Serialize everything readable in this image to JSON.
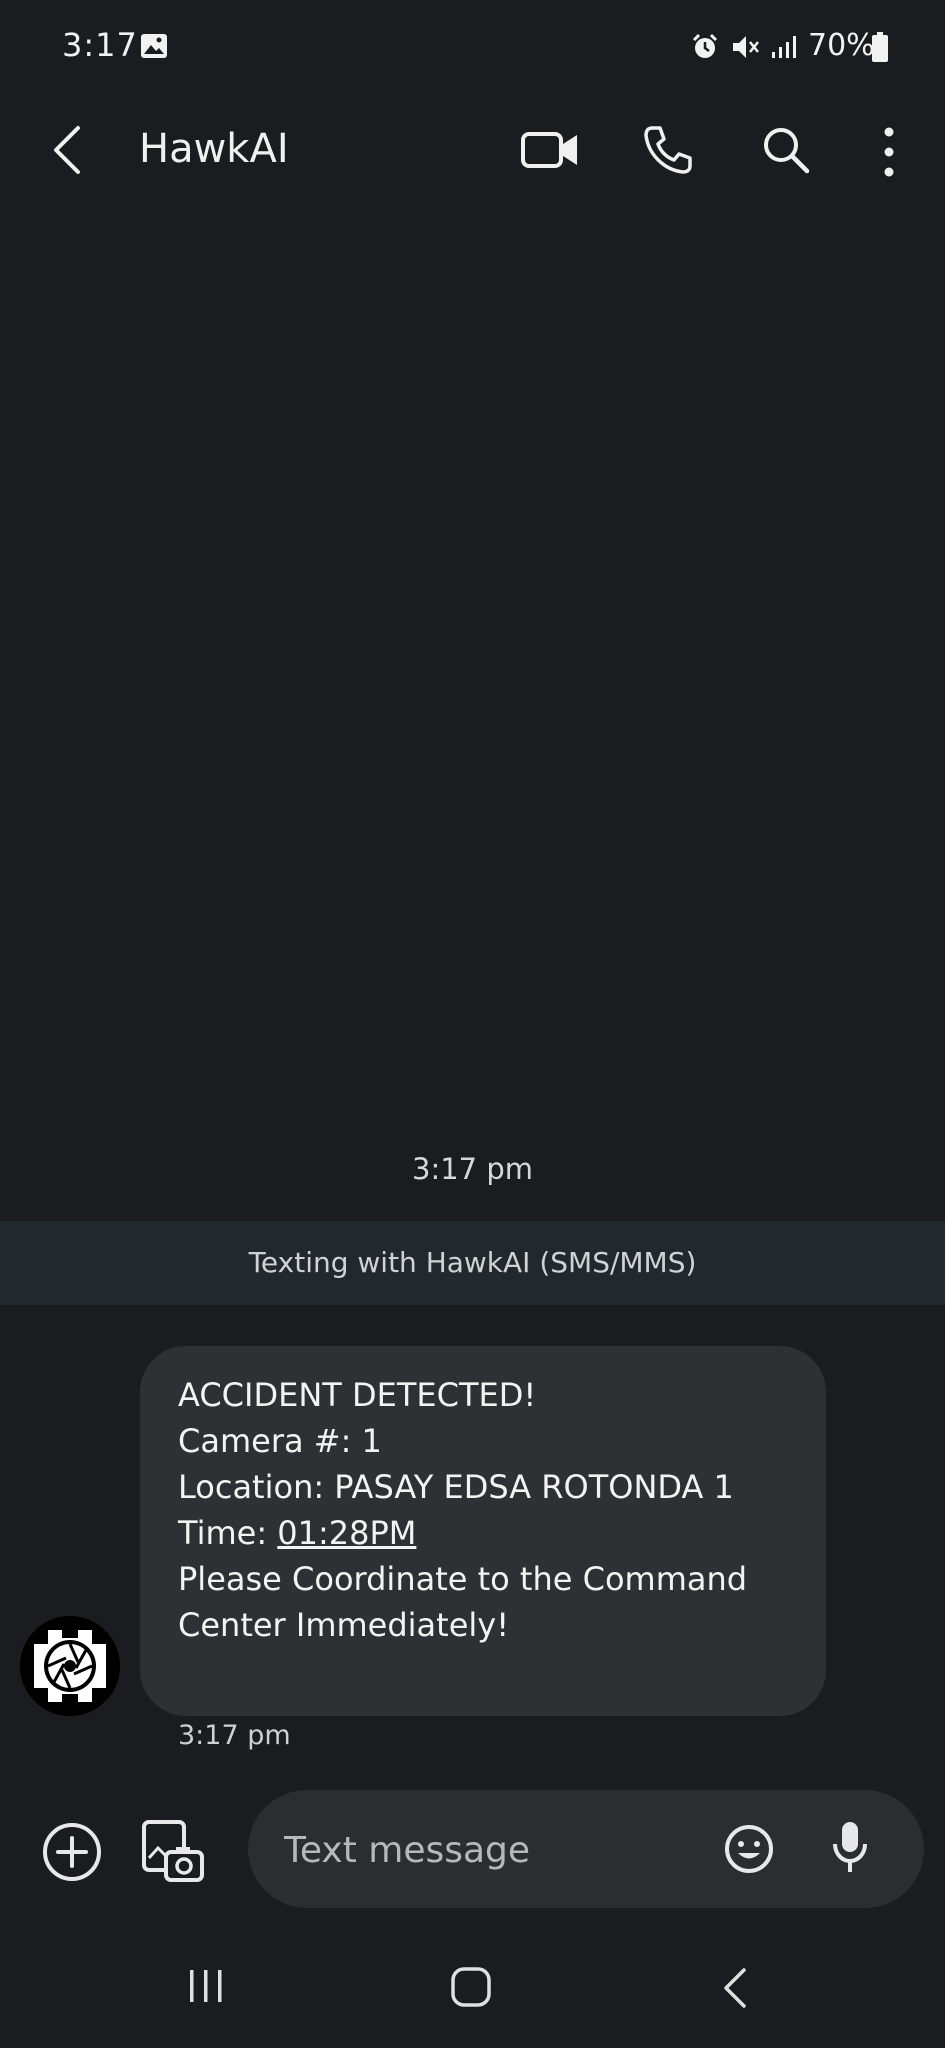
{
  "status_bar": {
    "time": "3:17",
    "battery": "70%"
  },
  "header": {
    "title": "HawkAI"
  },
  "conversation": {
    "top_time": "3:17 pm",
    "banner": "Texting with HawkAI (SMS/MMS)",
    "message": {
      "line1": "ACCIDENT DETECTED!",
      "line2": "Camera #: 1",
      "line3": "Location: PASAY EDSA ROTONDA 1",
      "line4_label": "Time: ",
      "line4_value": "01:28PM",
      "line5": "Please Coordinate to the Command",
      "line6": "Center Immediately!",
      "time": "3:17 pm"
    }
  },
  "composer": {
    "placeholder": "Text message"
  },
  "icons": [
    "gallery-icon",
    "alarm-icon",
    "mute-icon",
    "signal-icon",
    "battery-icon",
    "back-icon",
    "video-call-icon",
    "phone-icon",
    "search-icon",
    "more-icon",
    "avatar",
    "add-icon",
    "gallery-attach-icon",
    "emoji-icon",
    "mic-icon",
    "recents-icon",
    "home-icon",
    "nav-back-icon"
  ]
}
